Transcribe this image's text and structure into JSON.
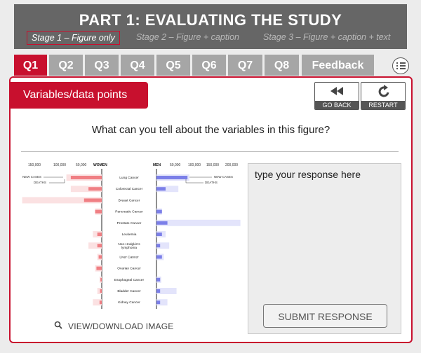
{
  "header": {
    "title": "PART 1: EVALUATING THE STUDY",
    "stages": [
      "Stage 1 – Figure only",
      "Stage 2 – Figure + caption",
      "Stage 3 – Figure + caption + text"
    ],
    "active_stage": 0
  },
  "tabs": [
    "Q1",
    "Q2",
    "Q3",
    "Q4",
    "Q5",
    "Q6",
    "Q7",
    "Q8",
    "Feedback"
  ],
  "active_tab": 0,
  "panel": {
    "section_label": "Variables/data points",
    "go_back": "GO BACK",
    "restart": "RESTART",
    "question": "What can you tell about the variables in this figure?",
    "view_link": "VIEW/DOWNLOAD IMAGE",
    "response_placeholder": "type your response here",
    "submit_label": "SUBMIT RESPONSE"
  },
  "colors": {
    "accent": "#c8102e",
    "header_bg": "#666666",
    "tab_bg": "#a6a6a6",
    "women_color": "#f07f84",
    "men_color": "#7b7fe8"
  },
  "chart_data": {
    "type": "bar",
    "left_axis_label": "WOMEN",
    "right_axis_label": "MEN",
    "left_ticks": [
      "150,000",
      "100,000",
      "50,000"
    ],
    "right_ticks": [
      "50,000",
      "100,000",
      "150,000",
      "200,000"
    ],
    "annotations": {
      "women_new_cases": "NEW CASES",
      "women_deaths": "DEATHS",
      "men_new_cases": "NEW CASES",
      "men_deaths": "DEATHS"
    },
    "categories": [
      "Lung Cancer",
      "Colorectal Cancer",
      "Breast Cancer",
      "Pancreatic Cancer",
      "Prostate Cancer",
      "Leukemia",
      "Non-Hodgkin's lymphoma",
      "Liver Cancer",
      "Ovarian Cancer",
      "Esophageal Cancer",
      "Bladder Cancer",
      "Kidney Cancer"
    ],
    "series": [
      {
        "name": "NEW CASES",
        "side": "WOMEN",
        "values": [
          80000,
          70000,
          180000,
          15000,
          0,
          20000,
          30000,
          10000,
          15000,
          5000,
          10000,
          20000
        ]
      },
      {
        "name": "DEATHS",
        "side": "WOMEN",
        "values": [
          70000,
          30000,
          40000,
          15000,
          0,
          10000,
          10000,
          7000,
          12000,
          3000,
          4000,
          5000
        ]
      },
      {
        "name": "NEW CASES",
        "side": "MEN",
        "values": [
          90000,
          60000,
          0,
          15000,
          230000,
          25000,
          35000,
          20000,
          0,
          13000,
          55000,
          30000
        ]
      },
      {
        "name": "DEATHS",
        "side": "MEN",
        "values": [
          85000,
          25000,
          0,
          15000,
          30000,
          15000,
          10000,
          15000,
          0,
          10000,
          10000,
          10000
        ]
      }
    ],
    "xlim": [
      0,
      200000
    ],
    "grid": false
  }
}
